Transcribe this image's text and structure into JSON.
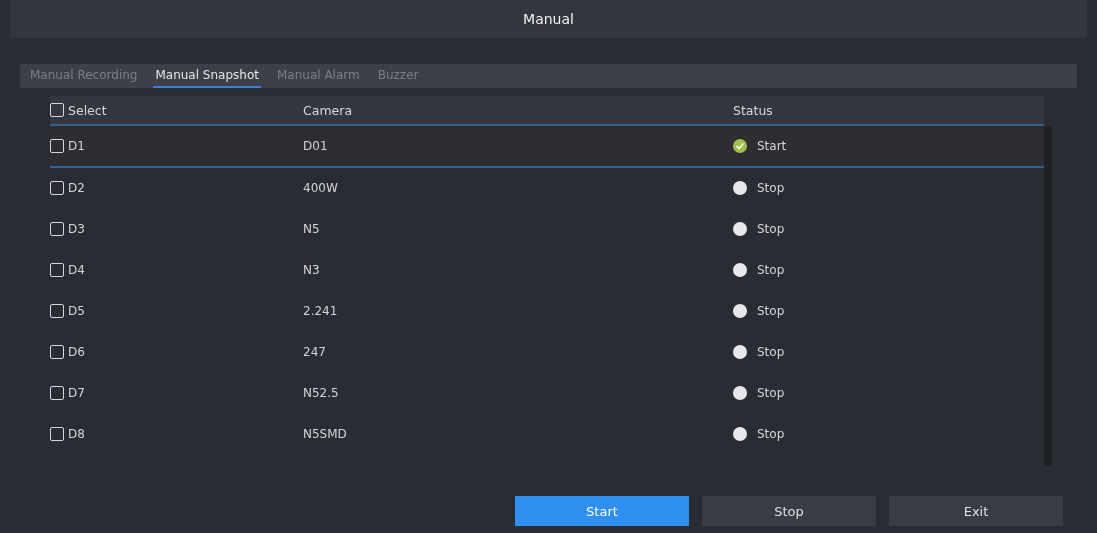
{
  "window": {
    "title": "Manual"
  },
  "tabs": [
    {
      "label": "Manual Recording",
      "selected": false
    },
    {
      "label": "Manual Snapshot",
      "selected": true
    },
    {
      "label": "Manual Alarm",
      "selected": false
    },
    {
      "label": "Buzzer",
      "selected": false
    }
  ],
  "table": {
    "columns": [
      "Select",
      "Camera",
      "Status"
    ],
    "select_all": {
      "checked": false
    },
    "rows": [
      {
        "channel": "D1",
        "camera": "D01",
        "status": "Start",
        "running": true,
        "checked": false,
        "selected": true
      },
      {
        "channel": "D2",
        "camera": "400W",
        "status": "Stop",
        "running": false,
        "checked": false,
        "selected": false
      },
      {
        "channel": "D3",
        "camera": "N5",
        "status": "Stop",
        "running": false,
        "checked": false,
        "selected": false
      },
      {
        "channel": "D4",
        "camera": "N3",
        "status": "Stop",
        "running": false,
        "checked": false,
        "selected": false
      },
      {
        "channel": "D5",
        "camera": "2.241",
        "status": "Stop",
        "running": false,
        "checked": false,
        "selected": false
      },
      {
        "channel": "D6",
        "camera": "247",
        "status": "Stop",
        "running": false,
        "checked": false,
        "selected": false
      },
      {
        "channel": "D7",
        "camera": "N52.5",
        "status": "Stop",
        "running": false,
        "checked": false,
        "selected": false
      },
      {
        "channel": "D8",
        "camera": "N5SMD",
        "status": "Stop",
        "running": false,
        "checked": false,
        "selected": false
      }
    ]
  },
  "buttons": [
    {
      "label": "Start",
      "primary": true
    },
    {
      "label": "Stop",
      "primary": false
    },
    {
      "label": "Exit",
      "primary": false
    }
  ]
}
